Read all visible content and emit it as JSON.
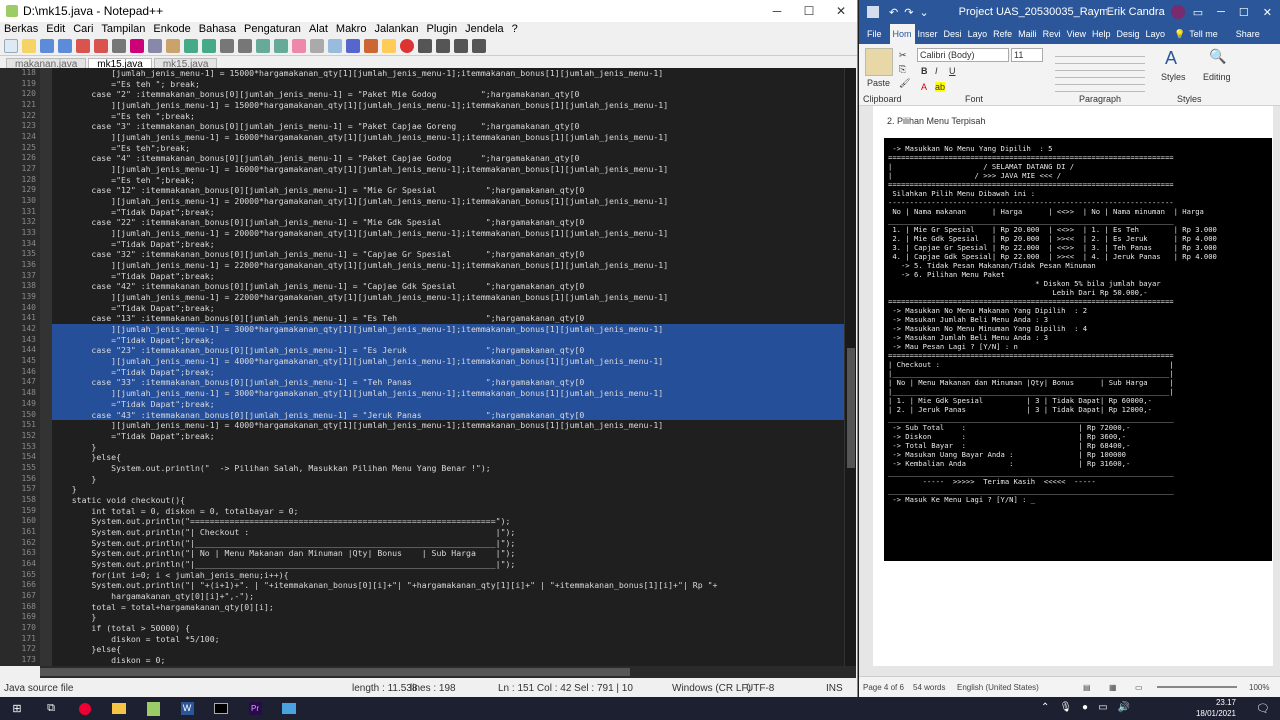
{
  "npp": {
    "title": "D:\\mk15.java - Notepad++",
    "menu": [
      "Berkas",
      "Edit",
      "Cari",
      "Tampilan",
      "Enkode",
      "Bahasa",
      "Pengaturan",
      "Alat",
      "Makro",
      "Jalankan",
      "Plugin",
      "Jendela",
      "?"
    ],
    "tabs": [
      "makanan.java",
      "mk15.java",
      "mk15.java"
    ],
    "lines": [
      {
        "n": "118",
        "t": "            [jumlah_jenis_menu-1] = 15000*hargamakanan_qty[1][jumlah_jenis_menu-1];itemmakanan_bonus[1][jumlah_jenis_menu-1]"
      },
      {
        "n": "119",
        "t": "            =\"Es teh \"; break;"
      },
      {
        "n": "120",
        "t": "        case \"2\" :itemmakanan_bonus[0][jumlah_jenis_menu-1] = \"Paket Mie Godog         \";hargamakanan_qty[0"
      },
      {
        "n": "121",
        "t": "            ][jumlah_jenis_menu-1] = 15000*hargamakanan_qty[1][jumlah_jenis_menu-1];itemmakanan_bonus[1][jumlah_jenis_menu-1]"
      },
      {
        "n": "122",
        "t": "            =\"Es teh \";break;"
      },
      {
        "n": "123",
        "t": "        case \"3\" :itemmakanan_bonus[0][jumlah_jenis_menu-1] = \"Paket Capjae Goreng     \";hargamakanan_qty[0"
      },
      {
        "n": "124",
        "t": "            ][jumlah_jenis_menu-1] = 16000*hargamakanan_qty[1][jumlah_jenis_menu-1];itemmakanan_bonus[1][jumlah_jenis_menu-1]"
      },
      {
        "n": "125",
        "t": "            =\"Es teh\";break;"
      },
      {
        "n": "126",
        "t": "        case \"4\" :itemmakanan_bonus[0][jumlah_jenis_menu-1] = \"Paket Capjae Godog      \";hargamakanan_qty[0"
      },
      {
        "n": "127",
        "t": "            ][jumlah_jenis_menu-1] = 16000*hargamakanan_qty[1][jumlah_jenis_menu-1];itemmakanan_bonus[1][jumlah_jenis_menu-1]"
      },
      {
        "n": "128",
        "t": "            =\"Es teh \";break;"
      },
      {
        "n": "129",
        "t": "        case \"12\" :itemmakanan_bonus[0][jumlah_jenis_menu-1] = \"Mie Gr Spesial          \";hargamakanan_qty[0"
      },
      {
        "n": "130",
        "t": "            ][jumlah_jenis_menu-1] = 20000*hargamakanan_qty[1][jumlah_jenis_menu-1];itemmakanan_bonus[1][jumlah_jenis_menu-1]"
      },
      {
        "n": "131",
        "t": "            =\"Tidak Dapat\";break;"
      },
      {
        "n": "132",
        "t": "        case \"22\" :itemmakanan_bonus[0][jumlah_jenis_menu-1] = \"Mie Gdk Spesial         \";hargamakanan_qty[0"
      },
      {
        "n": "133",
        "t": "            ][jumlah_jenis_menu-1] = 20000*hargamakanan_qty[1][jumlah_jenis_menu-1];itemmakanan_bonus[1][jumlah_jenis_menu-1]"
      },
      {
        "n": "134",
        "t": "            =\"Tidak Dapat\";break;"
      },
      {
        "n": "135",
        "t": "        case \"32\" :itemmakanan_bonus[0][jumlah_jenis_menu-1] = \"Capjae Gr Spesial       \";hargamakanan_qty[0"
      },
      {
        "n": "136",
        "t": "            ][jumlah_jenis_menu-1] = 22000*hargamakanan_qty[1][jumlah_jenis_menu-1];itemmakanan_bonus[1][jumlah_jenis_menu-1]"
      },
      {
        "n": "137",
        "t": "            =\"Tidak Dapat\";break;"
      },
      {
        "n": "138",
        "t": "        case \"42\" :itemmakanan_bonus[0][jumlah_jenis_menu-1] = \"Capjae Gdk Spesial      \";hargamakanan_qty[0"
      },
      {
        "n": "139",
        "t": "            ][jumlah_jenis_menu-1] = 22000*hargamakanan_qty[1][jumlah_jenis_menu-1];itemmakanan_bonus[1][jumlah_jenis_menu-1]"
      },
      {
        "n": "140",
        "t": "            =\"Tidak Dapat\";break;"
      },
      {
        "n": "141",
        "t": "        case \"13\" :itemmakanan_bonus[0][jumlah_jenis_menu-1] = \"Es Teh                  \";hargamakanan_qty[0"
      },
      {
        "n": "142",
        "t": "            ][jumlah_jenis_menu-1] = 3000*hargamakanan_qty[1][jumlah_jenis_menu-1];itemmakanan_bonus[1][jumlah_jenis_menu-1]",
        "s": true
      },
      {
        "n": "143",
        "t": "            =\"Tidak Dapat\";break;",
        "s": true
      },
      {
        "n": "144",
        "t": "        case \"23\" :itemmakanan_bonus[0][jumlah_jenis_menu-1] = \"Es Jeruk                \";hargamakanan_qty[0",
        "s": true
      },
      {
        "n": "145",
        "t": "            ][jumlah_jenis_menu-1] = 4000*hargamakanan_qty[1][jumlah_jenis_menu-1];itemmakanan_bonus[1][jumlah_jenis_menu-1]",
        "s": true
      },
      {
        "n": "146",
        "t": "            =\"Tidak Dapat\";break;",
        "s": true
      },
      {
        "n": "147",
        "t": "        case \"33\" :itemmakanan_bonus[0][jumlah_jenis_menu-1] = \"Teh Panas               \";hargamakanan_qty[0",
        "s": true
      },
      {
        "n": "148",
        "t": "            ][jumlah_jenis_menu-1] = 3000*hargamakanan_qty[1][jumlah_jenis_menu-1];itemmakanan_bonus[1][jumlah_jenis_menu-1]",
        "s": true
      },
      {
        "n": "149",
        "t": "            =\"Tidak Dapat\";break;",
        "s": true
      },
      {
        "n": "150",
        "t": "        case \"43\" :itemmakanan_bonus[0][jumlah_jenis_menu-1] = \"Jeruk Panas             \";hargamakanan_qty[0",
        "s": true
      },
      {
        "n": "151",
        "t": "            ][jumlah_jenis_menu-1] = 4000*hargamakanan_qty[1][jumlah_jenis_menu-1];itemmakanan_bonus[1][jumlah_jenis_menu-1]"
      },
      {
        "n": "152",
        "t": "            =\"Tidak Dapat\";break;"
      },
      {
        "n": "153",
        "t": "        }"
      },
      {
        "n": "154",
        "t": "        }else{"
      },
      {
        "n": "155",
        "t": "            System.out.println(\"  -> Pilihan Salah, Masukkan Pilihan Menu Yang Benar !\");"
      },
      {
        "n": "156",
        "t": "        }"
      },
      {
        "n": "157",
        "t": "    }"
      },
      {
        "n": "158",
        "t": "    static void checkout(){"
      },
      {
        "n": "159",
        "t": "        int total = 0, diskon = 0, totalbayar = 0;"
      },
      {
        "n": "160",
        "t": "        System.out.println(\"==============================================================\");"
      },
      {
        "n": "161",
        "t": "        System.out.println(\"| Checkout :                                                  |\");"
      },
      {
        "n": "162",
        "t": "        System.out.println(\"|_____________________________________________________________|\");"
      },
      {
        "n": "163",
        "t": "        System.out.println(\"| No | Menu Makanan dan Minuman |Qty| Bonus    | Sub Harga    |\");"
      },
      {
        "n": "164",
        "t": "        System.out.println(\"|_____________________________________________________________|\");"
      },
      {
        "n": "165",
        "t": "        for(int i=0; i < jumlah_jenis_menu;i++){"
      },
      {
        "n": "166",
        "t": "        System.out.println(\"| \"+(i+1)+\". | \"+itemmakanan_bonus[0][i]+\"| \"+hargamakanan_qty[1][i]+\" | \"+itemmakanan_bonus[1][i]+\"| Rp \"+"
      },
      {
        "n": "167",
        "t": "            hargamakanan_qty[0][i]+\",-\");"
      },
      {
        "n": "168",
        "t": "        total = total+hargamakanan_qty[0][i];"
      },
      {
        "n": "169",
        "t": "        }"
      },
      {
        "n": "170",
        "t": "        if (total > 50000) {"
      },
      {
        "n": "171",
        "t": "            diskon = total *5/100;"
      },
      {
        "n": "172",
        "t": "        }else{"
      },
      {
        "n": "173",
        "t": "            diskon = 0;"
      }
    ],
    "status": {
      "lang": "Java source file",
      "length": "length : 11.538",
      "lines": "lines : 198",
      "pos": "Ln : 151   Col : 42   Sel : 791 | 10",
      "eol": "Windows (CR LF)",
      "enc": "UTF-8",
      "ins": "INS"
    }
  },
  "word": {
    "title": "Project UAS_20530035_Raymu...",
    "user": "Erik Candra",
    "tabs": [
      "File",
      "Hom",
      "Inser",
      "Desi",
      "Layo",
      "Refe",
      "Maili",
      "Revi",
      "View",
      "Help",
      "Desig",
      "Layo"
    ],
    "tellme": "Tell me",
    "share": "Share",
    "font_name": "Calibri (Body)",
    "font_size": "11",
    "paste": "Paste",
    "styles": "Styles",
    "editing": "Editing",
    "groups": [
      "Clipboard",
      "Font",
      "Paragraph",
      "Styles"
    ],
    "heading_text": "2.  Pilihan Menu Terpisah",
    "console_lines": [
      " -> Masukkan No Menu Yang Dipilih  : 5",
      "==================================================================",
      "|                     / SELAMAT DATANG DI /",
      "|                   / >>> JAVA MIE <<< /",
      "==================================================================",
      "",
      " Silahkan Pilih Menu Dibawah ini :",
      "------------------------------------------------------------------",
      " No | Nama makanan      | Harga      | <<>>  | No | Nama minuman  | Harga",
      "__________________________________________________________________",
      " 1. | Mie Gr Spesial    | Rp 20.000  | <<>>  | 1. | Es Teh        | Rp 3.000",
      " 2. | Mie Gdk Spesial   | Rp 20.000  | >><<  | 2. | Es Jeruk      | Rp 4.000",
      " 3. | Capjae Gr Spesial | Rp 22.000  | <<>>  | 3. | Teh Panas     | Rp 3.000",
      " 4. | Capjae Gdk Spesial| Rp 22.000  | >><<  | 4. | Jeruk Panas   | Rp 4.000",
      "",
      "   -> 5. Tidak Pesan Makanan/Tidak Pesan Minuman",
      "   -> 6. Pilihan Menu Paket",
      "",
      "                                  * Diskon 5% bila jumlah bayar",
      "                                      Lebih Dari Rp 50.000,-",
      "==================================================================",
      " -> Masukkan No Menu Makanan Yang Dipilih  : 2",
      " -> Masukan Jumlah Beli Menu Anda : 3",
      " -> Masukkan No Menu Minuman Yang Dipilih  : 4",
      " -> Masukan Jumlah Beli Menu Anda : 3",
      " -> Mau Pesan Lagi ? [Y/N] : n",
      "==================================================================",
      "| Checkout :                                                     |",
      "|________________________________________________________________|",
      "| No | Menu Makanan dan Minuman |Qty| Bonus      | Sub Harga     |",
      "|________________________________________________________________|",
      "| 1. | Mie Gdk Spesial          | 3 | Tidak Dapat| Rp 60000,-",
      "| 2. | Jeruk Panas              | 3 | Tidak Dapat| Rp 12000,-",
      "__________________________________________________________________",
      " -> Sub Total    :                          | Rp 72000,-",
      " -> Diskon       :                          | Rp 3600,-",
      " -> Total Bayar  :                          | Rp 68400,-",
      " -> Masukan Uang Bayar Anda :               | Rp 100000",
      " -> Kembalian Anda          :               | Rp 31600,-",
      "__________________________________________________________________",
      "        -----  >>>>>  Terima Kasih  <<<<<  -----",
      "__________________________________________________________________",
      "",
      " -> Masuk Ke Menu Lagi ? [Y/N] : _"
    ],
    "status": {
      "page": "Page 4 of 6",
      "words": "54 words",
      "lang": "English (United States)",
      "zoom": "100%"
    }
  },
  "taskbar": {
    "time": "23.17",
    "date": "18/01/2021"
  }
}
